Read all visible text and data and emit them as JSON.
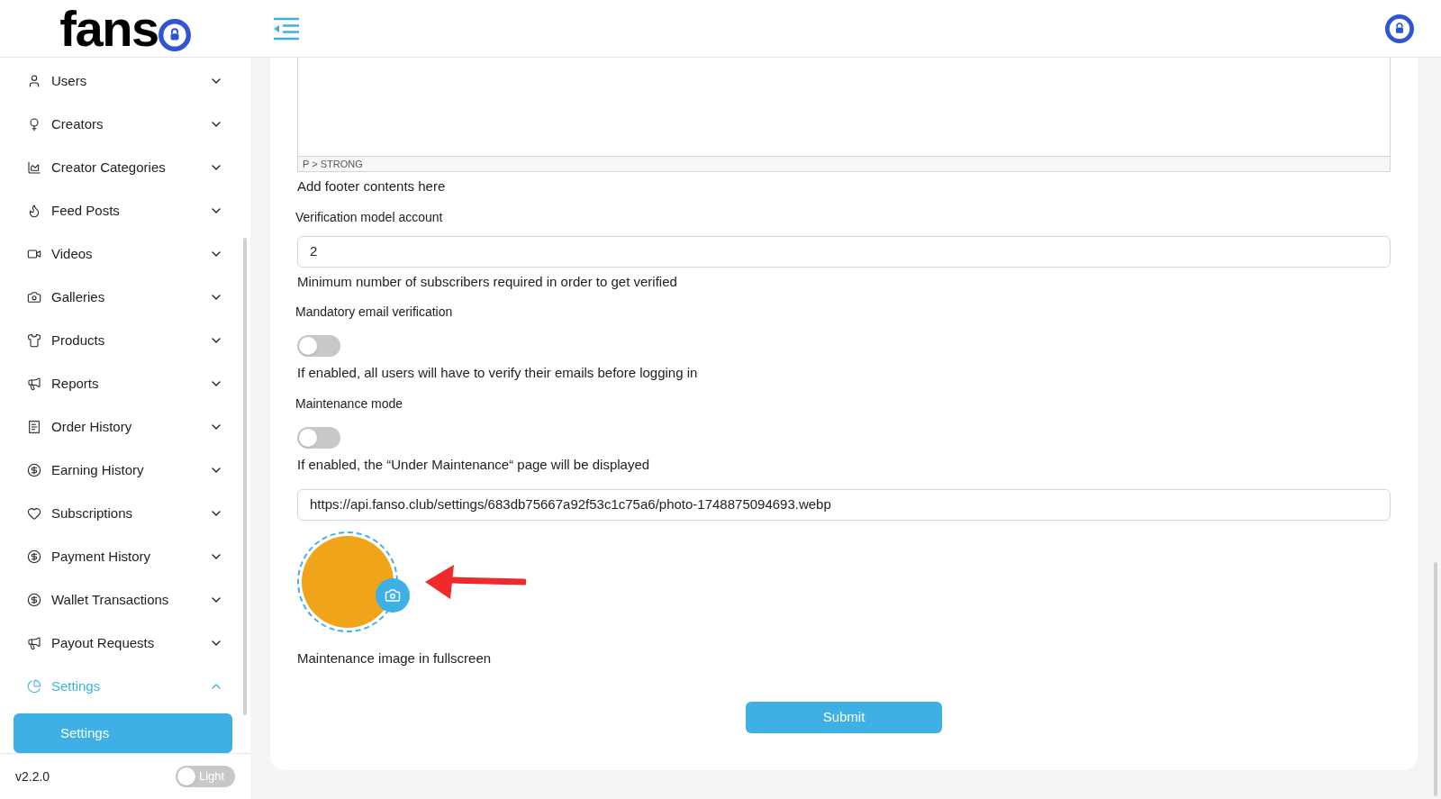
{
  "header": {
    "logo_text": "fans"
  },
  "sidebar": {
    "items": [
      {
        "label": "Users",
        "expanded": false,
        "selected": false
      },
      {
        "label": "Creators",
        "expanded": false,
        "selected": false
      },
      {
        "label": "Creator Categories",
        "expanded": false,
        "selected": false
      },
      {
        "label": "Feed Posts",
        "expanded": false,
        "selected": false
      },
      {
        "label": "Videos",
        "expanded": false,
        "selected": false
      },
      {
        "label": "Galleries",
        "expanded": false,
        "selected": false
      },
      {
        "label": "Products",
        "expanded": false,
        "selected": false
      },
      {
        "label": "Reports",
        "expanded": false,
        "selected": false
      },
      {
        "label": "Order History",
        "expanded": false,
        "selected": false
      },
      {
        "label": "Earning History",
        "expanded": false,
        "selected": false
      },
      {
        "label": "Subscriptions",
        "expanded": false,
        "selected": false
      },
      {
        "label": "Payment History",
        "expanded": false,
        "selected": false
      },
      {
        "label": "Wallet Transactions",
        "expanded": false,
        "selected": false
      },
      {
        "label": "Payout Requests",
        "expanded": false,
        "selected": false
      },
      {
        "label": "Settings",
        "expanded": true,
        "selected": true,
        "children": [
          {
            "label": "Settings",
            "selected": true
          }
        ]
      }
    ],
    "version": "v2.2.0",
    "theme_toggle": {
      "label": "Light",
      "on": false
    }
  },
  "form": {
    "editor_path": "P > STRONG",
    "editor_help": "Add footer contents here",
    "verification": {
      "label": "Verification model account",
      "value": "2",
      "help": "Minimum number of subscribers required in order to get verified"
    },
    "email_verification": {
      "label": "Mandatory email verification",
      "on": false,
      "help": "If enabled, all users will have to verify their emails before logging in"
    },
    "maintenance": {
      "label": "Maintenance mode",
      "on": false,
      "help": "If enabled, the “Under Maintenance“ page will be displayed"
    },
    "image_url": "https://api.fanso.club/settings/683db75667a92f53c1c75a6/photo-1748875094693.webp",
    "image_help": "Maintenance image in fullscreen",
    "submit": "Submit"
  }
}
